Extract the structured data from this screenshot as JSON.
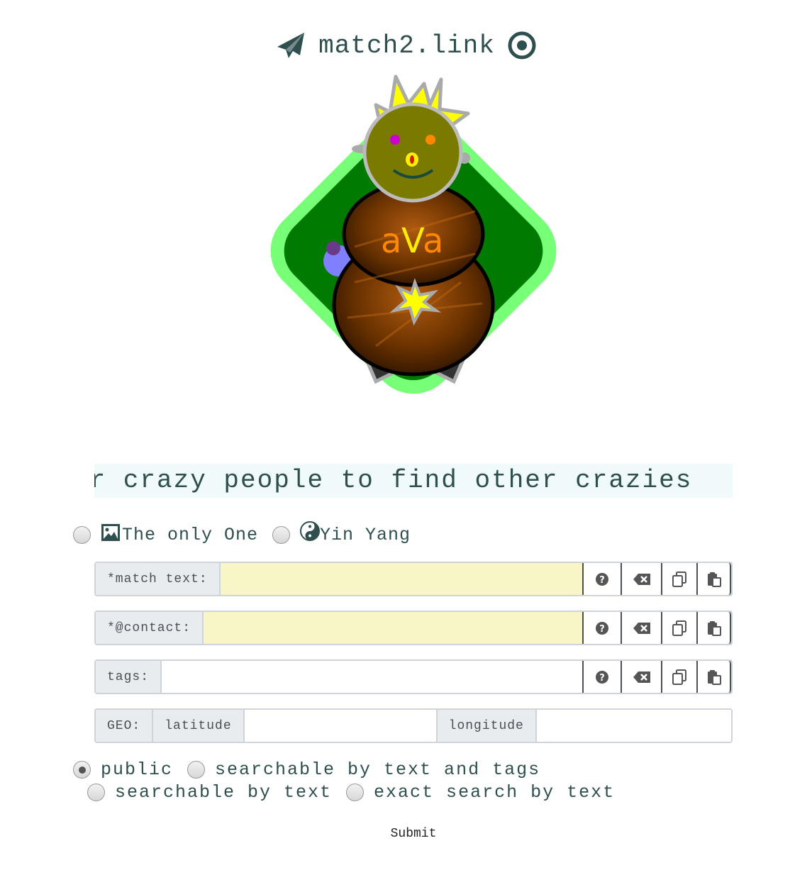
{
  "header": {
    "title": "match2.link",
    "left_icon": "paper-plane-icon",
    "right_icon": "target-icon"
  },
  "avatar": {
    "label": "aVa",
    "colors": {
      "outer_ring": "#77ff77",
      "inner_diamond": "#007a00",
      "head": "#7a7a00",
      "body": "#6a3200",
      "label_orange": "#ff8800",
      "label_yellow": "#ffee00"
    }
  },
  "tagline": "or crazy people to find other crazies",
  "mode": {
    "options": [
      {
        "label": "The only One",
        "icon": "image-icon",
        "checked": false
      },
      {
        "label": "Yin Yang",
        "icon": "yin-yang-icon",
        "checked": false
      }
    ]
  },
  "fields": {
    "match_text": {
      "label": "*match text:",
      "value": ""
    },
    "contact": {
      "label": "*@contact:",
      "value": ""
    },
    "tags": {
      "label": "tags:",
      "value": ""
    }
  },
  "geo": {
    "label": "GEO:",
    "latitude_label": "latitude",
    "longitude_label": "longitude",
    "latitude_value": "",
    "longitude_value": ""
  },
  "buttons": {
    "help_icon": "question-circle-icon",
    "clear_icon": "backspace-icon",
    "copy_icon": "copy-icon",
    "paste_icon": "paste-icon"
  },
  "visibility": {
    "options": [
      {
        "label": "public",
        "checked": true
      },
      {
        "label": "searchable by text and tags",
        "checked": false
      },
      {
        "label": "searchable by text",
        "checked": false
      },
      {
        "label": "exact search by text",
        "checked": false
      }
    ]
  },
  "submit_label": "Submit",
  "colors": {
    "text": "#2f4f4f",
    "required_bg": "#f8f6c7",
    "addon_bg": "#e9ecef",
    "tagline_bg": "#f0fafa"
  }
}
